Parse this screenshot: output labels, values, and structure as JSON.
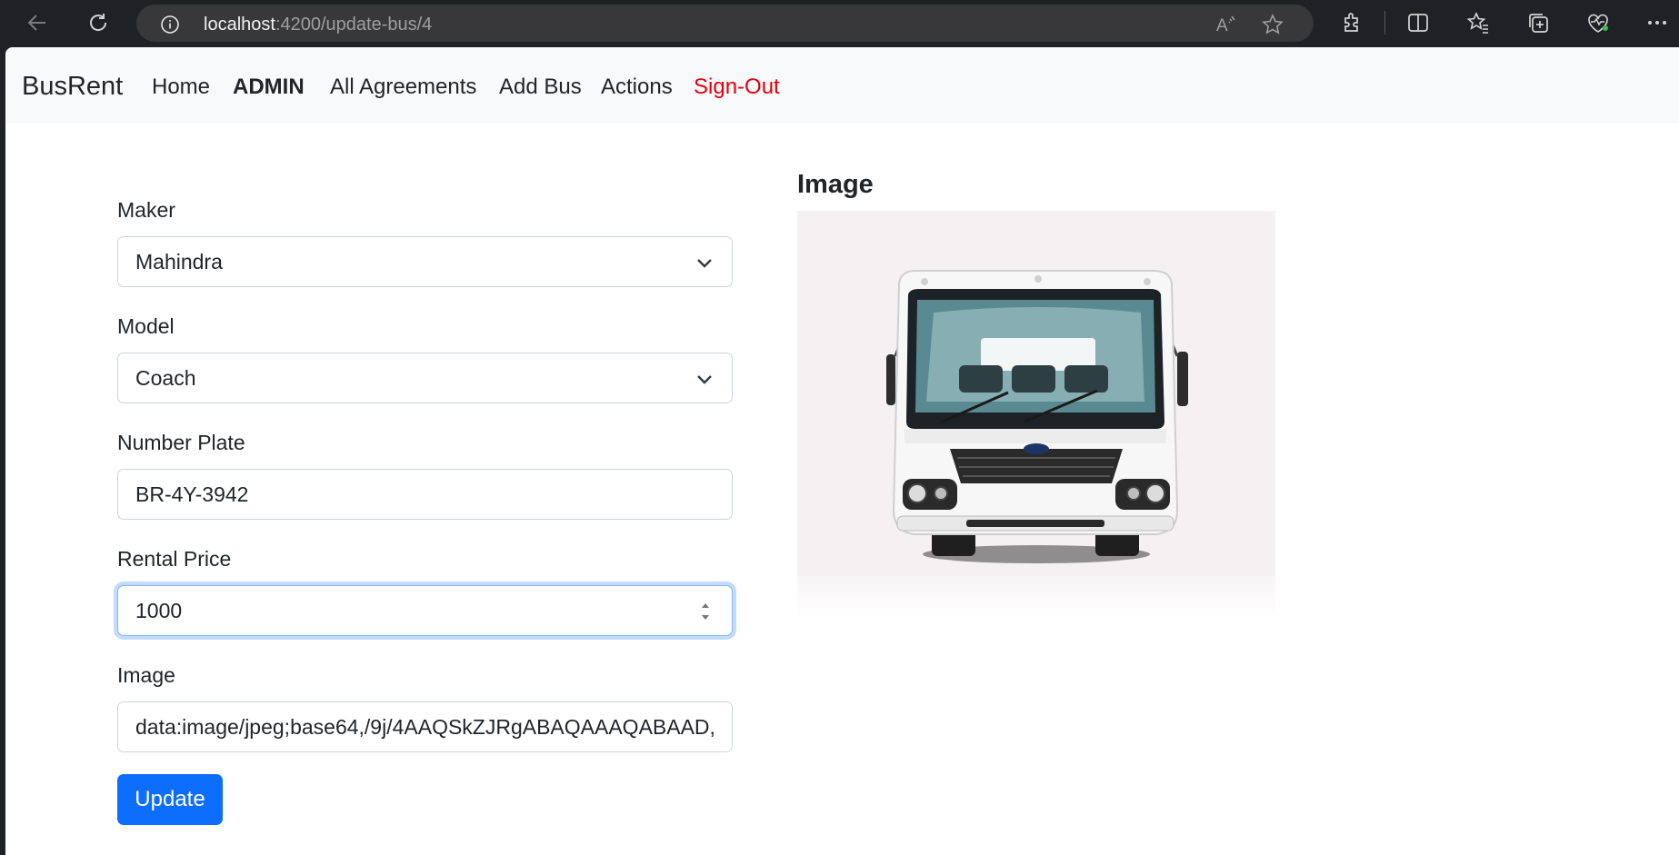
{
  "browser": {
    "url_host": "localhost",
    "url_path": ":4200/update-bus/4",
    "read_aloud_label": "A"
  },
  "navbar": {
    "brand": "BusRent",
    "links": [
      {
        "label": "Home"
      },
      {
        "label": "ADMIN"
      },
      {
        "label": "All Agreements"
      },
      {
        "label": "Add Bus"
      },
      {
        "label": "Actions"
      },
      {
        "label": "Sign-Out"
      }
    ]
  },
  "form": {
    "maker": {
      "label": "Maker",
      "value": "Mahindra"
    },
    "model": {
      "label": "Model",
      "value": "Coach"
    },
    "number_plate": {
      "label": "Number Plate",
      "value": "BR-4Y-3942"
    },
    "rental_price": {
      "label": "Rental Price",
      "value": "1000"
    },
    "image": {
      "label": "Image",
      "value": "data:image/jpeg;base64,/9j/4AAQSkZJRgABAQAAAQABAAD,"
    },
    "submit_label": "Update"
  },
  "preview": {
    "title": "Image"
  },
  "colors": {
    "primary": "#0d6efd",
    "danger": "#e1000f",
    "navbar_bg": "#f8f9fa",
    "chrome_bg": "#202124"
  }
}
